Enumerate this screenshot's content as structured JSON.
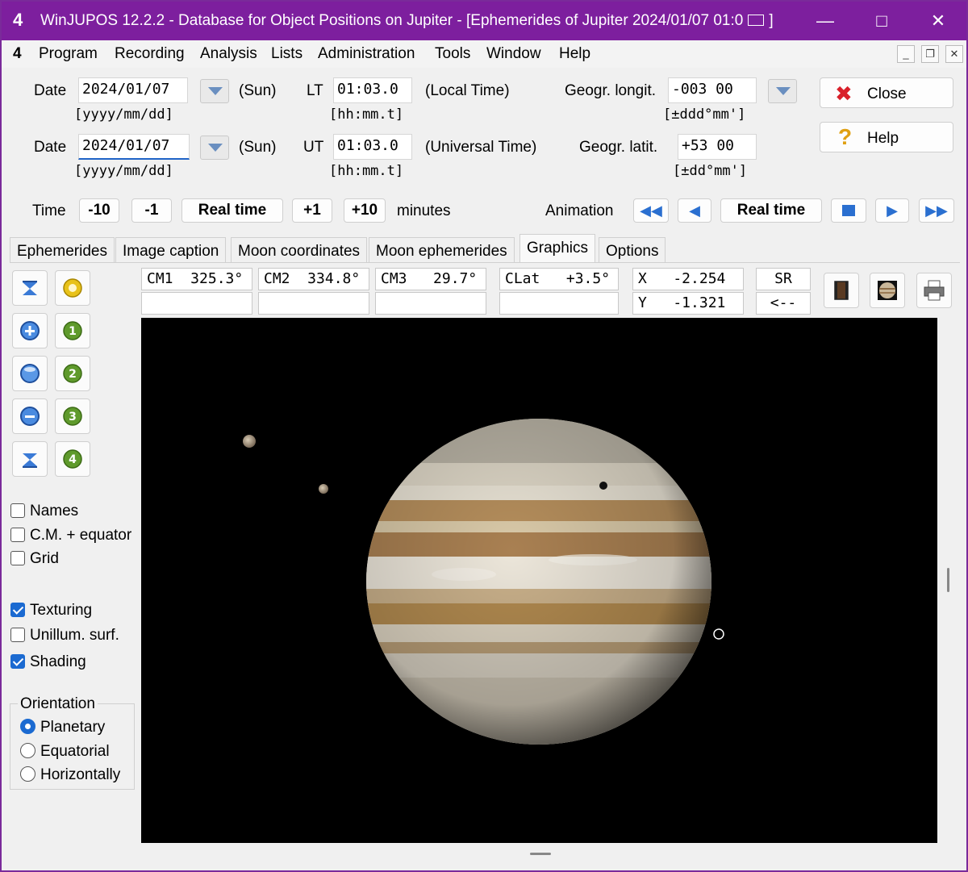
{
  "window": {
    "title": "WinJUPOS 12.2.2 - Database for Object Positions on Jupiter - [Ephemerides of Jupiter  2024/01/07  01:0",
    "title_end": "]",
    "app_icon": "4"
  },
  "menu": [
    "Program",
    "Recording",
    "Analysis",
    "Lists",
    "Administration",
    "Tools",
    "Window",
    "Help"
  ],
  "date_rows": [
    {
      "label": "Date",
      "value": "2024/01/07",
      "day": "(Sun)",
      "format": "[yyyy/mm/dd]",
      "time_label": "LT",
      "time_value": "01:03.0",
      "time_desc": "(Local Time)",
      "time_format": "[hh:mm.t]"
    },
    {
      "label": "Date",
      "value": "2024/01/07",
      "day": "(Sun)",
      "format": "[yyyy/mm/dd]",
      "time_label": "UT",
      "time_value": "01:03.0",
      "time_desc": "(Universal Time)",
      "time_format": "[hh:mm.t]"
    }
  ],
  "geo": {
    "longit_label": "Geogr. longit.",
    "longit_value": "-003 00",
    "longit_format": "[±ddd°mm']",
    "latit_label": "Geogr. latit.",
    "latit_value": "+53 00",
    "latit_format": "[±dd°mm']"
  },
  "buttons": {
    "close": "Close",
    "help": "Help"
  },
  "time_row": {
    "label": "Time",
    "minus10": "-10",
    "minus1": "-1",
    "realtime": "Real time",
    "plus1": "+1",
    "plus10": "+10",
    "unit": "minutes"
  },
  "animation": {
    "label": "Animation",
    "realtime": "Real time"
  },
  "tabs": [
    "Ephemerides",
    "Image caption",
    "Moon coordinates",
    "Moon ephemerides",
    "Graphics",
    "Options"
  ],
  "active_tab": "Graphics",
  "info": {
    "cm1": "CM1  325.3°",
    "cm2": "CM2  334.8°",
    "cm3": "CM3   29.7°",
    "clat": "CLat   +3.5°",
    "x": "X   -2.254",
    "y": "Y   -1.321",
    "sr": "SR",
    "back": "<--"
  },
  "moon_buttons": [
    "1",
    "2",
    "3",
    "4"
  ],
  "checkboxes": [
    {
      "label": "Names",
      "checked": false
    },
    {
      "label": "C.M. + equator",
      "checked": false
    },
    {
      "label": "Grid",
      "checked": false
    },
    {
      "label": "Texturing",
      "checked": true
    },
    {
      "label": "Unillum. surf.",
      "checked": false
    },
    {
      "label": "Shading",
      "checked": true
    }
  ],
  "orientation": {
    "label": "Orientation",
    "options": [
      {
        "label": "Planetary",
        "selected": true
      },
      {
        "label": "Equatorial",
        "selected": false
      },
      {
        "label": "Horizontally",
        "selected": false
      }
    ]
  },
  "colors": {
    "titlebar": "#7d1f9e",
    "accent": "#1b6ad1",
    "canvas": "#000000"
  }
}
